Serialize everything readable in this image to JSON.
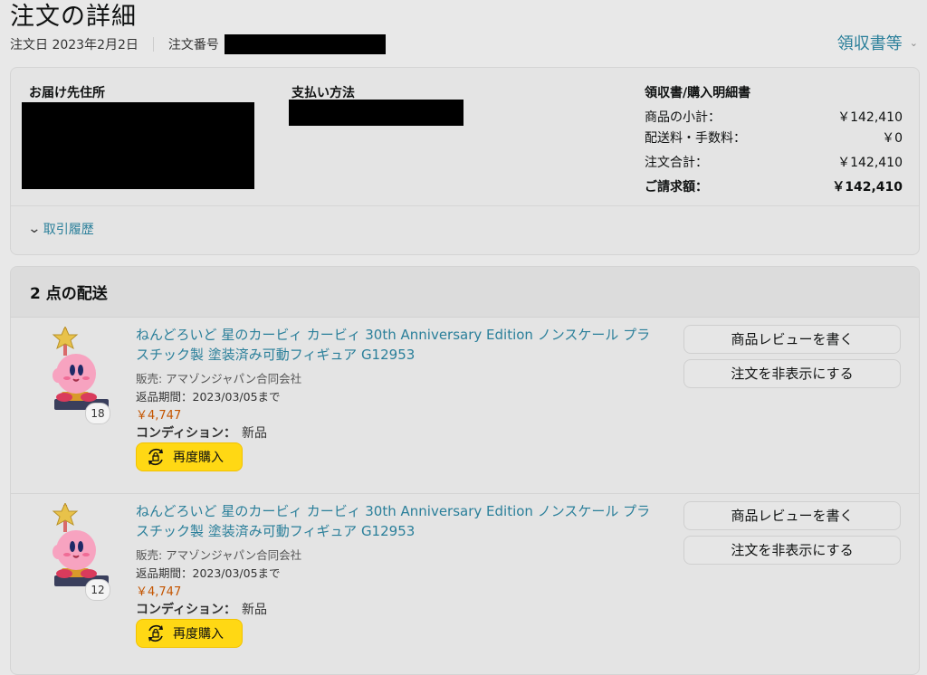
{
  "page": {
    "title": "注文の詳細",
    "order_date": "注文日 2023年2月2日",
    "order_number_label": "注文番号",
    "receipt_link": "領収書等"
  },
  "summary": {
    "address_heading": "お届け先住所",
    "payment_heading": "支払い方法",
    "receipt_heading": "領収書/購入明細書",
    "rows": [
      {
        "label": "商品の小計：",
        "value": "￥142,410"
      },
      {
        "label": "配送料・手数料：",
        "value": "￥0"
      },
      {
        "label": "注文合計：",
        "value": "￥142,410"
      },
      {
        "label": "ご請求額：",
        "value": "￥142,410"
      }
    ],
    "history_link": "取引履歴"
  },
  "shipment": {
    "heading": "2 点の配送",
    "items": [
      {
        "title": "ねんどろいど 星のカービィ カービィ 30th Anniversary Edition ノンスケール プラスチック製 塗装済み可動フィギュア G12953",
        "seller": "販売: アマゾンジャパン合同会社",
        "return_period": "返品期間：2023/03/05まで",
        "price": "￥4,747",
        "condition_label": "コンディション：",
        "condition_value": "新品",
        "quantity": "18",
        "rebuy_label": "再度購入",
        "review_button": "商品レビューを書く",
        "hide_button": "注文を非表示にする"
      },
      {
        "title": "ねんどろいど 星のカービィ カービィ 30th Anniversary Edition ノンスケール プラスチック製 塗装済み可動フィギュア G12953",
        "seller": "販売: アマゾンジャパン合同会社",
        "return_period": "返品期間：2023/03/05まで",
        "price": "￥4,747",
        "condition_label": "コンディション：",
        "condition_value": "新品",
        "quantity": "12",
        "rebuy_label": "再度購入",
        "review_button": "商品レビューを書く",
        "hide_button": "注文を非表示にする"
      }
    ]
  },
  "colors": {
    "link": "#2a7f9a",
    "price": "#c45500",
    "rebuy_button": "#ffd814",
    "redaction": "#000000"
  }
}
